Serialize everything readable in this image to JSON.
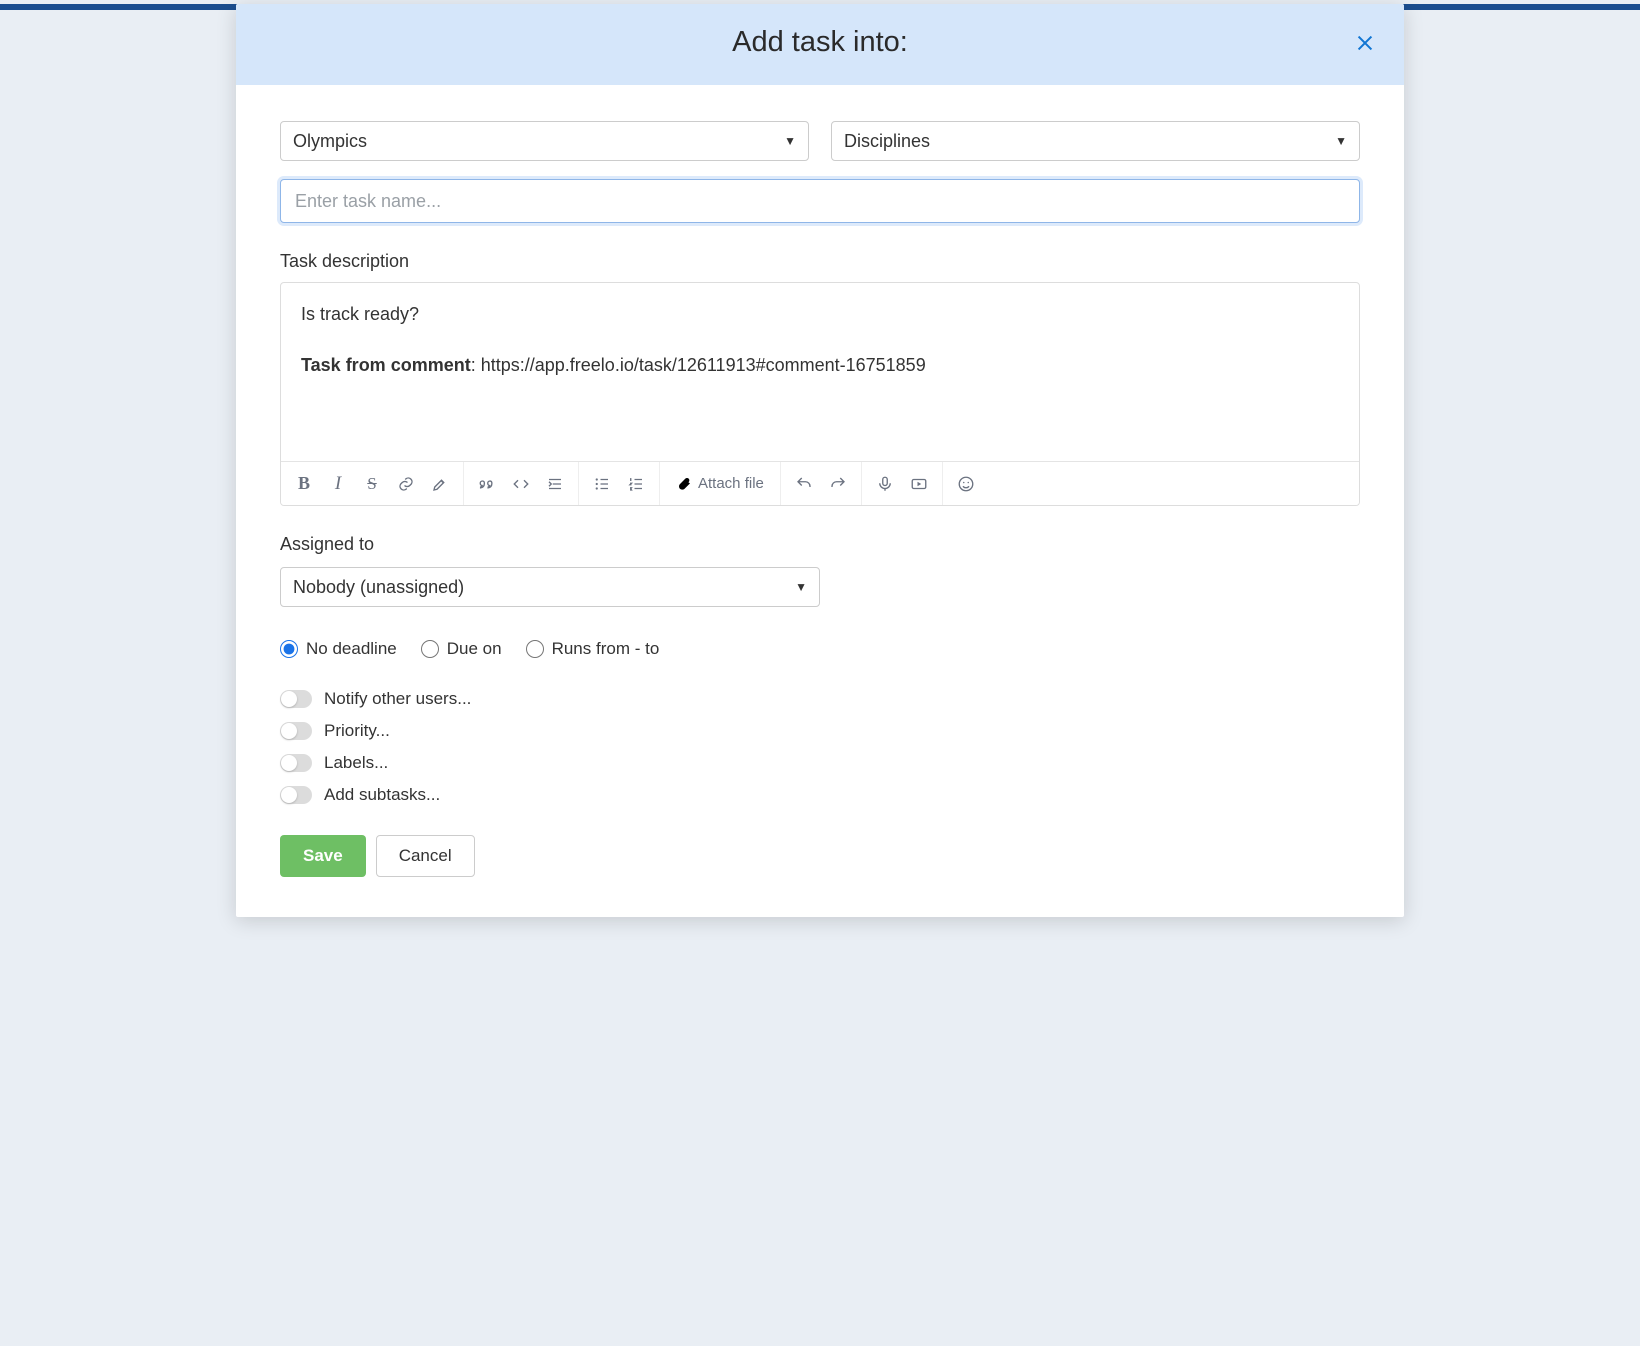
{
  "modal": {
    "title": "Add task into:",
    "project_select": "Olympics",
    "list_select": "Disciplines",
    "task_name_placeholder": "Enter task name...",
    "task_name_value": "",
    "description_label": "Task description",
    "description": {
      "line1": "Is track ready?",
      "comment_label": "Task from comment",
      "comment_sep": ": ",
      "comment_url": "https://app.freelo.io/task/12611913#comment-16751859"
    },
    "toolbar": {
      "attach_file": "Attach file"
    },
    "assigned_label": "Assigned to",
    "assigned_select": "Nobody (unassigned)",
    "deadline": {
      "no_deadline": "No deadline",
      "due_on": "Due on",
      "runs_from_to": "Runs from - to",
      "selected": "no_deadline"
    },
    "toggles": {
      "notify": "Notify other users...",
      "priority": "Priority...",
      "labels": "Labels...",
      "subtasks": "Add subtasks..."
    },
    "actions": {
      "save": "Save",
      "cancel": "Cancel"
    }
  }
}
